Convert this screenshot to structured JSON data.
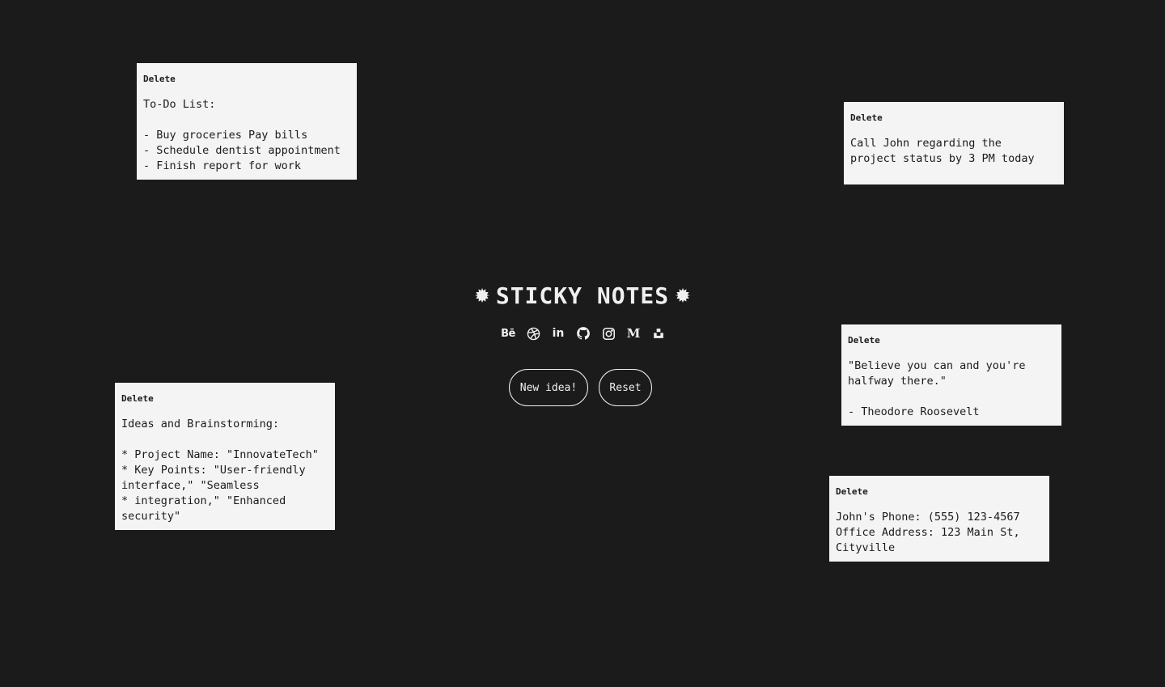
{
  "app": {
    "title": "STICKY NOTES",
    "background_color": "#1b1b1b",
    "note_color": "#f4f4f4"
  },
  "socials": [
    {
      "name": "behance",
      "glyph": "Bē"
    },
    {
      "name": "dribbble",
      "glyph": ""
    },
    {
      "name": "linkedin",
      "glyph": "in"
    },
    {
      "name": "github",
      "glyph": ""
    },
    {
      "name": "instagram",
      "glyph": ""
    },
    {
      "name": "medium",
      "glyph": "M"
    },
    {
      "name": "unsplash",
      "glyph": ""
    }
  ],
  "buttons": {
    "new_idea": "New idea!",
    "reset": "Reset"
  },
  "notes": [
    {
      "delete_label": "Delete",
      "text": "To-Do List:\n\n- Buy groceries Pay bills\n- Schedule dentist appointment\n- Finish report for work"
    },
    {
      "delete_label": "Delete",
      "text": "Call John regarding the\nproject status by 3 PM today"
    },
    {
      "delete_label": "Delete",
      "text": "\"Believe you can and you're\nhalfway there.\"\n\n- Theodore Roosevelt"
    },
    {
      "delete_label": "Delete",
      "text": "Ideas and Brainstorming:\n\n* Project Name: \"InnovateTech\"\n* Key Points: \"User-friendly\ninterface,\" \"Seamless\n* integration,\" \"Enhanced\nsecurity\""
    },
    {
      "delete_label": "Delete",
      "text": "John's Phone: (555) 123-4567\nOffice Address: 123 Main St,\nCityville"
    }
  ]
}
